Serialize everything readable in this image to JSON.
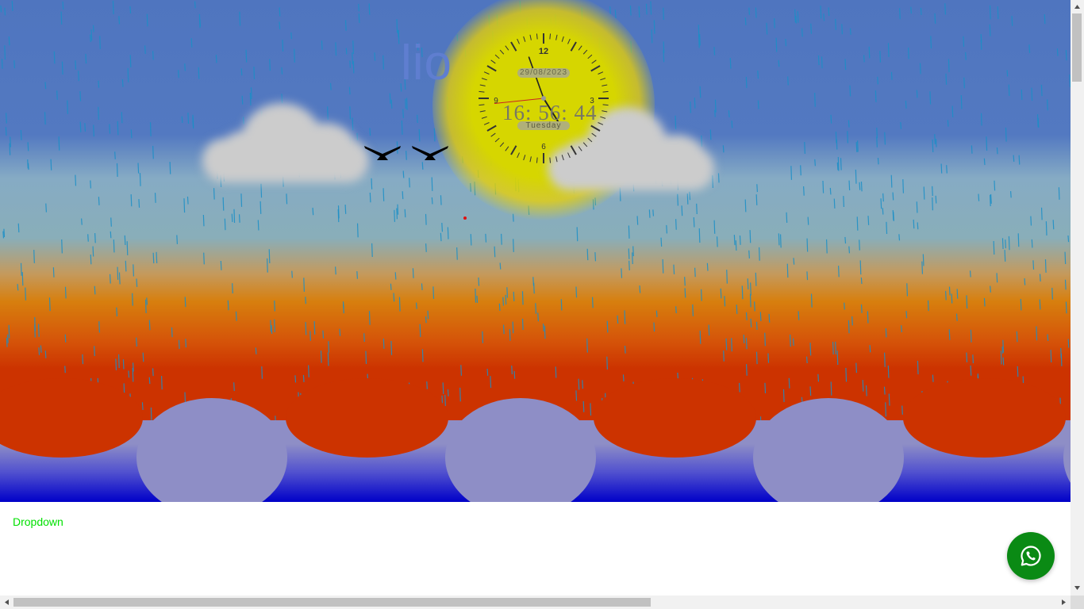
{
  "page": {
    "brand_text": "lio",
    "dropdown_label": "Dropdown"
  },
  "clock": {
    "date": "29/08/2023",
    "time": "16: 56: 44",
    "day": "Tuesday",
    "numerals": [
      "12",
      "3",
      "6",
      "9"
    ],
    "hours": 16,
    "minutes": 56,
    "seconds": 44
  },
  "colors": {
    "sky": "#4f75bf",
    "sun": "#d6d600",
    "sunset_red": "#cc3300",
    "sea": "#0000c8",
    "rain": "#1a8fc7",
    "dropdown_link": "#00e000",
    "whatsapp": "#0a8a14"
  },
  "icons": {
    "whatsapp": "whatsapp-icon",
    "scroll_up": "arrow-up-icon",
    "scroll_down": "arrow-down-icon",
    "scroll_left": "arrow-left-icon",
    "scroll_right": "arrow-right-icon"
  }
}
